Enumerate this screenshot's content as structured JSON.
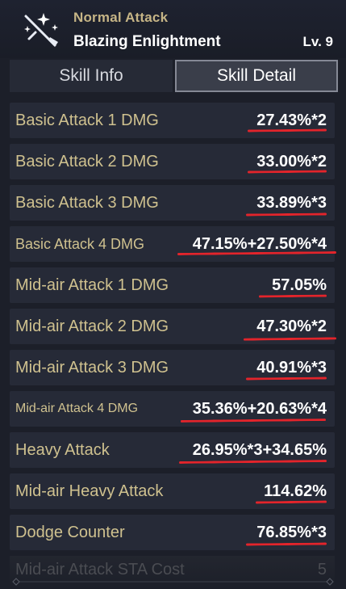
{
  "header": {
    "type_label": "Normal Attack",
    "skill_name": "Blazing Enlightment",
    "level": "Lv. 9",
    "icon": "crossed-swords-icon"
  },
  "tabs": [
    {
      "label": "Skill Info",
      "active": false
    },
    {
      "label": "Skill Detail",
      "active": true
    }
  ],
  "rows": [
    {
      "label": "Basic Attack 1 DMG",
      "value": "27.43%*2"
    },
    {
      "label": "Basic Attack 2 DMG",
      "value": "33.00%*2"
    },
    {
      "label": "Basic Attack 3 DMG",
      "value": "33.89%*3"
    },
    {
      "label": "Basic Attack 4 DMG",
      "value": "47.15%+27.50%*4"
    },
    {
      "label": "Mid-air Attack 1 DMG",
      "value": "57.05%"
    },
    {
      "label": "Mid-air Attack 2 DMG",
      "value": "47.30%*2"
    },
    {
      "label": "Mid-air Attack 3 DMG",
      "value": "40.91%*3"
    },
    {
      "label": "Mid-air Attack 4 DMG",
      "value": "35.36%+20.63%*4"
    },
    {
      "label": "Heavy Attack",
      "value": "26.95%*3+34.65%"
    },
    {
      "label": "Mid-air Heavy Attack",
      "value": "114.62%"
    },
    {
      "label": "Dodge Counter",
      "value": "76.85%*3"
    }
  ],
  "partial_row": {
    "label": "Mid-air Attack STA Cost",
    "value": "5"
  },
  "colors": {
    "label_gold": "#cfc18f",
    "underline_red": "#e3242b",
    "row_bg": "#262a37"
  }
}
